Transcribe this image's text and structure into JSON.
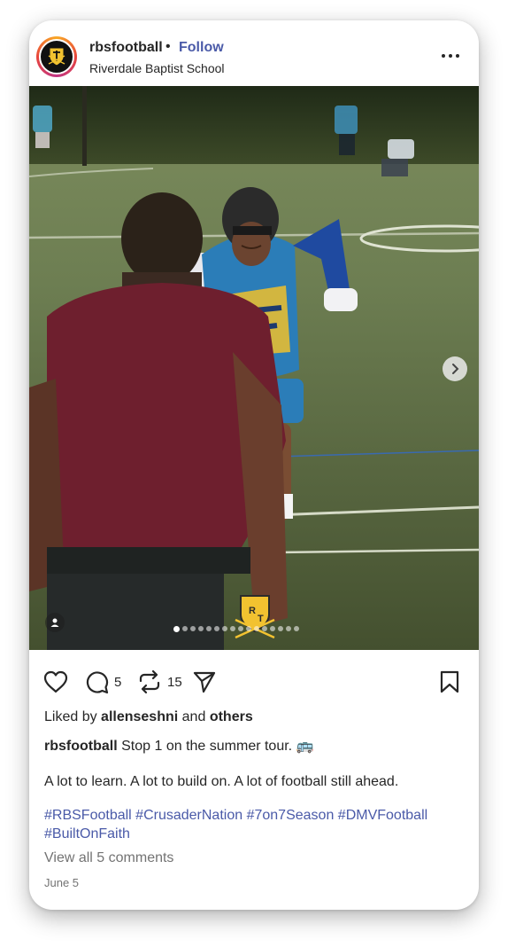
{
  "post": {
    "username": "rbsfootball",
    "separator": "•",
    "follow_label": "Follow",
    "location": "Riverdale Baptist School",
    "carousel": {
      "total": 16,
      "active_index": 0
    },
    "photo_watermark": "R T",
    "comment_count": "5",
    "repost_count": "15",
    "liked_by_prefix": "Liked by",
    "liked_by_user": "allenseshni",
    "liked_by_and": "and",
    "liked_by_others": "others",
    "caption_user": "rbsfootball",
    "caption_text": "Stop 1 on the summer tour. 🚌",
    "caption_body": "A lot to learn. A lot to build on. A lot of football still ahead.",
    "hashtags": [
      "#RBSFootball",
      "#CrusaderNation",
      "#7on7Season",
      "#DMVFootball",
      "#BuiltOnFaith"
    ],
    "view_comments": "View all 5 comments",
    "date": "June 5"
  },
  "icons": {
    "like": "heart-icon",
    "comment": "comment-bubble-icon",
    "repost": "repost-arrows-icon",
    "share": "paper-plane-icon",
    "save": "bookmark-icon",
    "more": "ellipsis-icon",
    "next": "chevron-right-icon",
    "tag": "person-tag-icon"
  },
  "colors": {
    "link": "#4a5aa8",
    "text": "#262626",
    "muted": "#737373",
    "accent_gold": "#f2c230"
  }
}
